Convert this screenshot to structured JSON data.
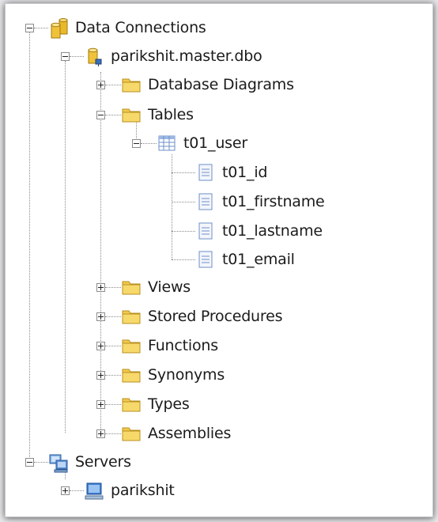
{
  "tree": {
    "root": {
      "label": "Data Connections",
      "icon": "database-connections-icon",
      "expanded": true
    },
    "connection": {
      "label": "parikshit.master.dbo",
      "icon": "database-connection-icon",
      "expanded": true
    },
    "folders": {
      "database_diagrams": {
        "label": "Database Diagrams",
        "expanded": false
      },
      "tables": {
        "label": "Tables",
        "expanded": true
      },
      "views": {
        "label": "Views",
        "expanded": false
      },
      "stored_procedures": {
        "label": "Stored Procedures",
        "expanded": false
      },
      "functions": {
        "label": "Functions",
        "expanded": false
      },
      "synonyms": {
        "label": "Synonyms",
        "expanded": false
      },
      "types": {
        "label": "Types",
        "expanded": false
      },
      "assemblies": {
        "label": "Assemblies",
        "expanded": false
      }
    },
    "table": {
      "label": "t01_user",
      "icon": "table-icon",
      "expanded": true,
      "columns": [
        "t01_id",
        "t01_firstname",
        "t01_lastname",
        "t01_email"
      ]
    },
    "servers": {
      "label": "Servers",
      "icon": "servers-icon",
      "expanded": true
    },
    "server": {
      "label": "parikshit",
      "icon": "server-computer-icon",
      "expanded": false
    }
  },
  "colors": {
    "folder": "#f2c94c",
    "cylinder": "#e9b92b",
    "table_grid": "#6e8fc9",
    "connector_lines": "#8a8a8a"
  }
}
